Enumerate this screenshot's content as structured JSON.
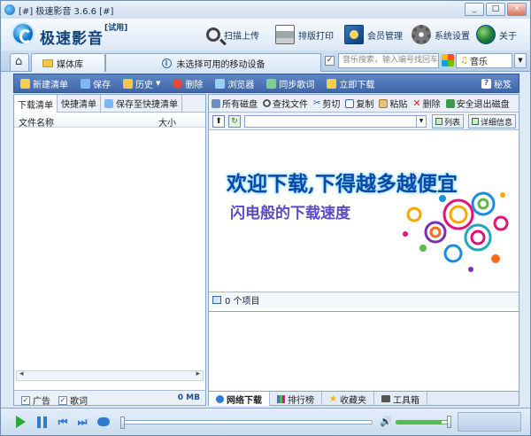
{
  "window": {
    "title": "[#] 极速影音 3.6.6 [#]",
    "buttons": [
      "_",
      "□",
      "×"
    ]
  },
  "header": {
    "logo": "极速影音",
    "badge": "[试用]",
    "buttons": [
      {
        "label": "扫描上传",
        "icon": "magnifier-icon"
      },
      {
        "label": "排版打印",
        "icon": "printer-icon"
      },
      {
        "label": "会员管理",
        "icon": "member-icon"
      },
      {
        "label": "系统设置",
        "icon": "gear-icon"
      },
      {
        "label": "关于",
        "icon": "globe-icon"
      }
    ]
  },
  "tabs": {
    "media": "媒体库",
    "device_notice": "未选择可用的移动设备",
    "search_placeholder": "音乐搜索，输入编号找回车",
    "music_label": "音乐"
  },
  "toolbar": {
    "items": [
      {
        "label": "新建清单",
        "color": "#f2d04b"
      },
      {
        "label": "保存",
        "color": "#7fb6f5"
      },
      {
        "label": "历史",
        "color": "#f4c64a"
      },
      {
        "label": "删除",
        "color": "#e2473b"
      },
      {
        "label": "浏览器",
        "color": "#9ad0f7"
      },
      {
        "label": "同步歌词",
        "color": "#7fd08f"
      },
      {
        "label": "立即下载",
        "color": "#f2d04b"
      }
    ],
    "secret": "秘笈"
  },
  "left": {
    "tabs": [
      "下载清单",
      "快捷清单",
      "保存至快捷清单"
    ],
    "columns": {
      "name": "文件名称",
      "size": "大小"
    },
    "footer": {
      "ad": "广告",
      "lyrics": "歌词",
      "total": "0 MB"
    }
  },
  "right": {
    "tools": [
      "所有磁盘",
      "查找文件",
      "剪切",
      "复制",
      "粘贴",
      "删除",
      "安全退出磁盘"
    ],
    "view_list": "列表",
    "view_detail": "详细信息",
    "banner": {
      "line1": "欢迎下载,下得越多越便宜",
      "line2": "闪电般的下载速度"
    },
    "status": "0 个项目",
    "tabs": [
      "网络下载",
      "排行榜",
      "收藏夹",
      "工具箱"
    ]
  },
  "player": {
    "progress": 0.0,
    "volume": 0.85
  }
}
